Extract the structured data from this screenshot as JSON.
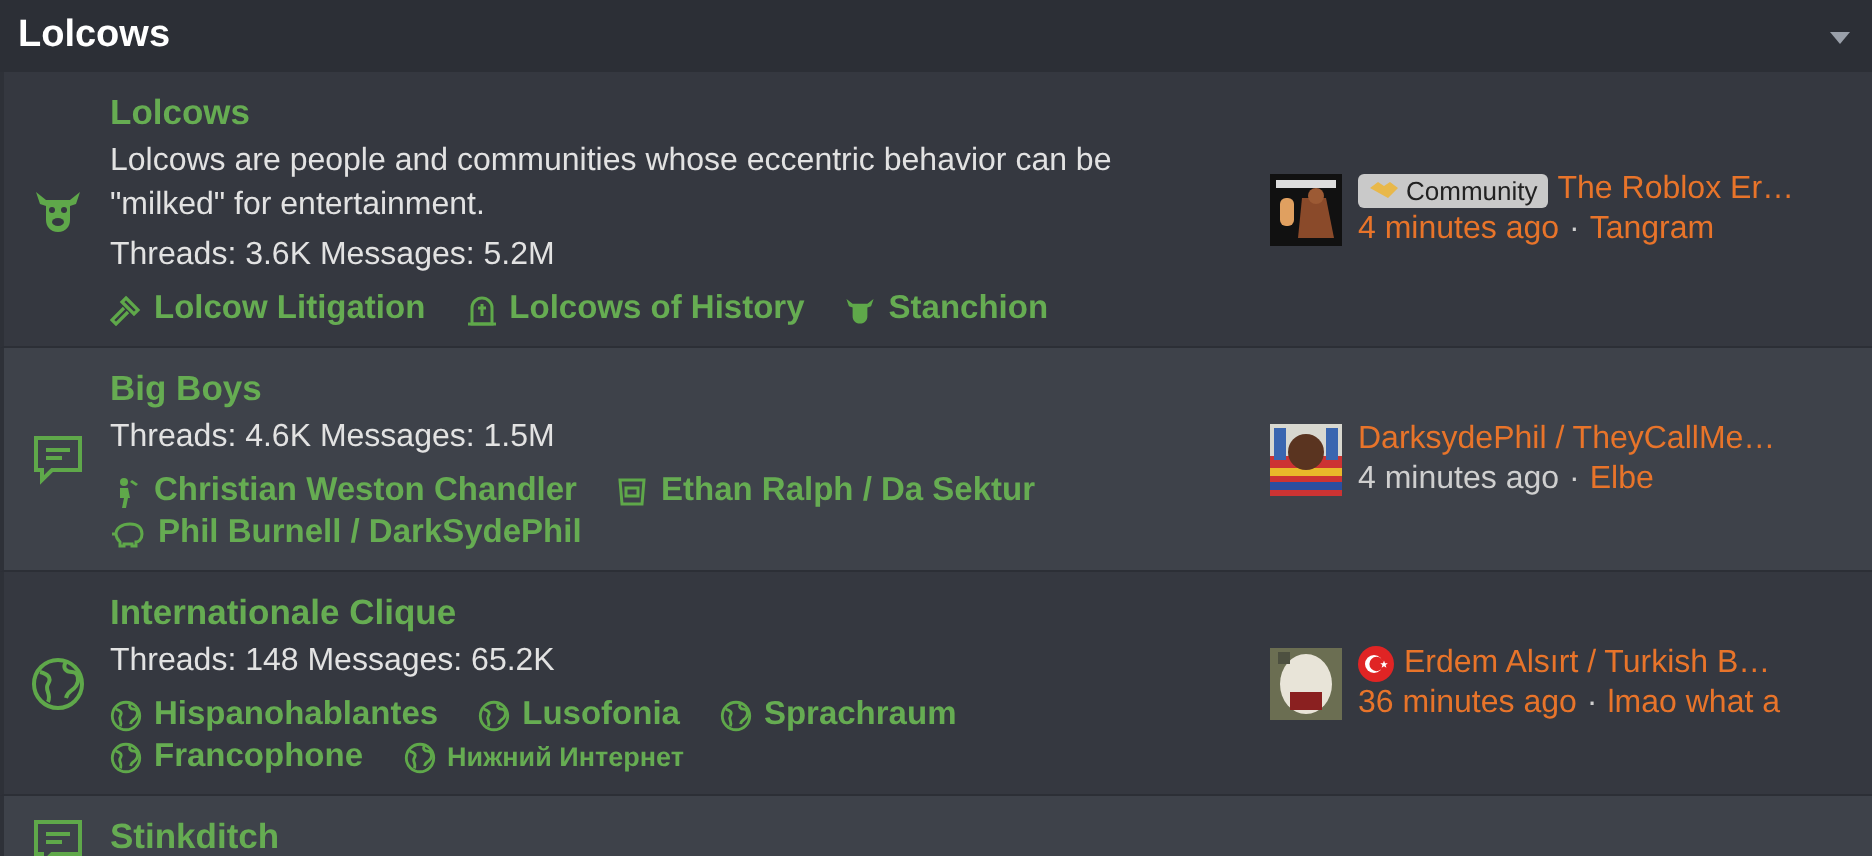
{
  "section": {
    "title": "Lolcows"
  },
  "forums": [
    {
      "title": "Lolcows",
      "description": "Lolcows are people and communities whose eccentric behavior can be \"milked\" for entertainment.",
      "stats": "Threads: 3.6K Messages: 5.2M",
      "subforums": [
        {
          "label": "Lolcow Litigation"
        },
        {
          "label": "Lolcows of History"
        },
        {
          "label": "Stanchion"
        }
      ],
      "latest": {
        "prefix": "Community",
        "flag": false,
        "thread": "The Roblox Er…",
        "time": "4 minutes ago",
        "unread": true,
        "separator": "·",
        "user": "Tangram"
      }
    },
    {
      "title": "Big Boys",
      "stats": "Threads: 4.6K Messages: 1.5M",
      "subforums": [
        {
          "label": "Christian Weston Chandler"
        },
        {
          "label": "Ethan Ralph / Da Sektur"
        },
        {
          "label": "Phil Burnell / DarkSydePhil"
        }
      ],
      "latest": {
        "flag": false,
        "thread": "DarksydePhil / TheyCallMe…",
        "time": "4 minutes ago",
        "unread": false,
        "separator": "·",
        "user": "Elbe"
      }
    },
    {
      "title": "Internationale Clique",
      "stats": "Threads: 148 Messages: 65.2K",
      "subforums": [
        {
          "label": "Hispanohablantes"
        },
        {
          "label": "Lusofonia"
        },
        {
          "label": "Sprachraum"
        },
        {
          "label": "Francophone"
        },
        {
          "label": "Нижний Интернет"
        }
      ],
      "latest": {
        "flag": true,
        "thread": "Erdem Alsırt / Turkish B…",
        "time": "36 minutes ago",
        "unread": true,
        "separator": "·",
        "user": "lmao what a"
      }
    },
    {
      "title": "Stinkditch"
    }
  ]
}
